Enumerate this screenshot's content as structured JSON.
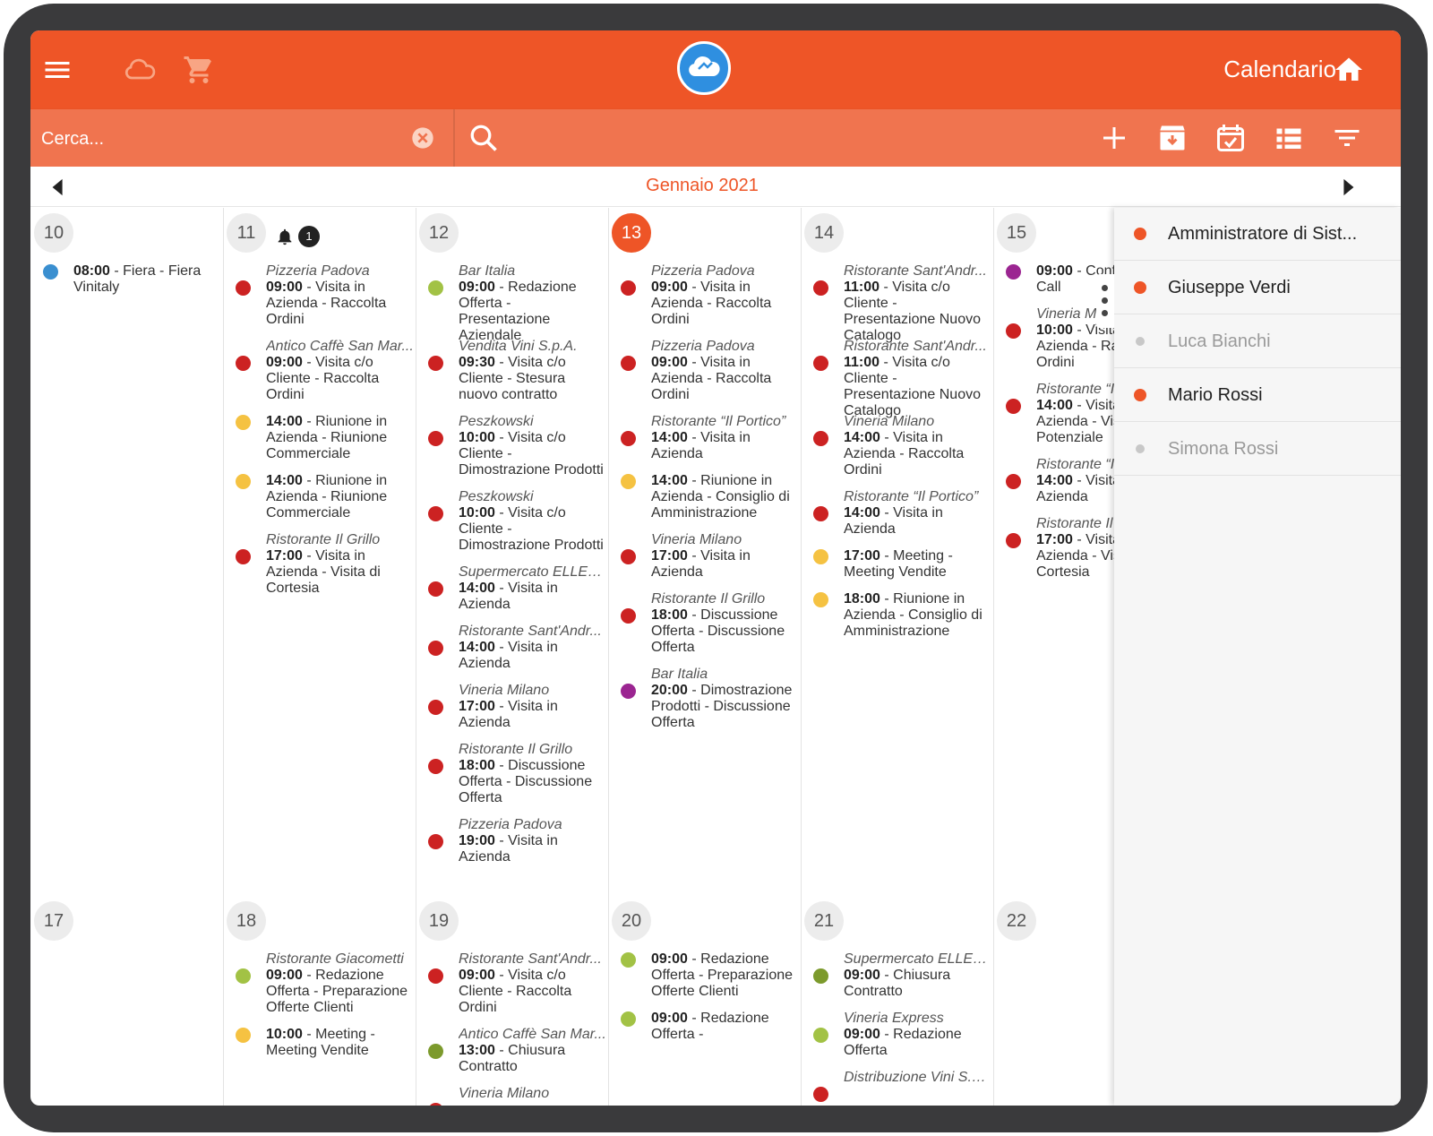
{
  "app": {
    "title": "Calendario"
  },
  "search": {
    "placeholder": "Cerca..."
  },
  "month": {
    "label": "Gennaio 2021"
  },
  "colors": {
    "accent": "#ee5527",
    "red": "#cc2222",
    "yellow": "#f5c242",
    "lightgreen": "#a2c245",
    "olive": "#7c9a2c",
    "purple": "#9b2591",
    "blue": "#3a8fd0"
  },
  "icons": [
    "menu-icon",
    "cloud-icon",
    "cart-icon",
    "home-icon",
    "close-circle-icon",
    "search-icon",
    "add-icon",
    "archive-icon",
    "calendar-check-icon",
    "list-icon",
    "filter-icon",
    "chevron-left-icon",
    "chevron-right-icon",
    "bell-icon",
    "more-vertical-icon"
  ],
  "users": [
    {
      "name": "Amministratore di Sist...",
      "active": true
    },
    {
      "name": "Giuseppe Verdi",
      "active": true
    },
    {
      "name": "Luca Bianchi",
      "active": false
    },
    {
      "name": "Mario Rossi",
      "active": true
    },
    {
      "name": "Simona Rossi",
      "active": false
    }
  ],
  "days": [
    {
      "num": "10",
      "events": [
        {
          "loc": "",
          "time": "08:00",
          "text": " - Fiera - Fiera Vinitaly",
          "color": "blue"
        }
      ]
    },
    {
      "num": "11",
      "badge": "1",
      "events": [
        {
          "loc": "Pizzeria Padova",
          "time": "09:00",
          "text": " - Visita in Azienda - Raccolta Ordini",
          "color": "red"
        },
        {
          "loc": "Antico Caffè San Mar...",
          "time": "09:00",
          "text": " - Visita c/o Cliente - Raccolta Ordini",
          "color": "red"
        },
        {
          "loc": "",
          "time": "14:00",
          "text": " - Riunione in Azienda - Riunione Commerciale",
          "color": "yellow"
        },
        {
          "loc": "",
          "time": "14:00",
          "text": " - Riunione in Azienda - Riunione Commerciale",
          "color": "yellow"
        },
        {
          "loc": "Ristorante Il Grillo",
          "time": "17:00",
          "text": " - Visita in Azienda - Visita di Cortesia",
          "color": "red"
        }
      ]
    },
    {
      "num": "12",
      "events": [
        {
          "loc": "Bar Italia",
          "time": "09:00",
          "text": " - Redazione Offerta - Presentazione Aziendale",
          "color": "lightgreen"
        },
        {
          "loc": "Vendita Vini S.p.A.",
          "time": "09:30",
          "text": " - Visita c/o Cliente - Stesura nuovo contratto",
          "color": "red"
        },
        {
          "loc": "Peszkowski",
          "time": "10:00",
          "text": " - Visita c/o Cliente - Dimostrazione Prodotti",
          "color": "red"
        },
        {
          "loc": "Peszkowski",
          "time": "10:00",
          "text": " - Visita c/o Cliente - Dimostrazione Prodotti",
          "color": "red"
        },
        {
          "loc": "Supermercato ELLES...",
          "time": "14:00",
          "text": " - Visita in Azienda",
          "color": "red"
        },
        {
          "loc": "Ristorante Sant'Andr...",
          "time": "14:00",
          "text": " - Visita in Azienda",
          "color": "red"
        },
        {
          "loc": "Vineria Milano",
          "time": "17:00",
          "text": " - Visita in Azienda",
          "color": "red"
        },
        {
          "loc": "Ristorante Il Grillo",
          "time": "18:00",
          "text": " - Discussione Offerta - Discussione Offerta",
          "color": "red"
        },
        {
          "loc": "Pizzeria Padova",
          "time": "19:00",
          "text": " - Visita in Azienda",
          "color": "red"
        }
      ]
    },
    {
      "num": "13",
      "today": true,
      "events": [
        {
          "loc": "Pizzeria Padova",
          "time": "09:00",
          "text": " - Visita in Azienda - Raccolta Ordini",
          "color": "red"
        },
        {
          "loc": "Pizzeria Padova",
          "time": "09:00",
          "text": " - Visita in Azienda - Raccolta Ordini",
          "color": "red"
        },
        {
          "loc": "Ristorante “Il Portico”",
          "time": "14:00",
          "text": " - Visita in Azienda",
          "color": "red"
        },
        {
          "loc": "",
          "time": "14:00",
          "text": " - Riunione in Azienda - Consiglio di Amministrazione",
          "color": "yellow"
        },
        {
          "loc": "Vineria Milano",
          "time": "17:00",
          "text": " - Visita in Azienda",
          "color": "red"
        },
        {
          "loc": "Ristorante Il Grillo",
          "time": "18:00",
          "text": " - Discussione Offerta - Discussione Offerta",
          "color": "red"
        },
        {
          "loc": "Bar Italia",
          "time": "20:00",
          "text": " - Dimostrazione Prodotti - Discussione Offerta",
          "color": "purple"
        }
      ]
    },
    {
      "num": "14",
      "events": [
        {
          "loc": "Ristorante Sant'Andr...",
          "time": "11:00",
          "text": " - Visita c/o Cliente - Presentazione Nuovo Catalogo",
          "color": "red"
        },
        {
          "loc": "Ristorante Sant'Andr...",
          "time": "11:00",
          "text": " - Visita c/o Cliente - Presentazione Nuovo Catalogo",
          "color": "red"
        },
        {
          "loc": "Vineria Milano",
          "time": "14:00",
          "text": " - Visita in Azienda - Raccolta Ordini",
          "color": "red"
        },
        {
          "loc": "Ristorante “Il Portico”",
          "time": "14:00",
          "text": " - Visita in Azienda",
          "color": "red"
        },
        {
          "loc": "",
          "time": "17:00",
          "text": " - Meeting - Meeting Vendite",
          "color": "yellow"
        },
        {
          "loc": "",
          "time": "18:00",
          "text": " - Riunione in Azienda - Consiglio di Amministrazione",
          "color": "yellow"
        }
      ]
    },
    {
      "num": "15",
      "events": [
        {
          "loc": "",
          "time": "09:00",
          "text": " - Conference Call",
          "color": "purple"
        },
        {
          "loc": "Vineria Milano",
          "time": "10:00",
          "text": " - Visita in Azienda - Raccolta Ordini",
          "color": "red"
        },
        {
          "loc": "Ristorante “Il Portico”",
          "time": "14:00",
          "text": " - Visita in Azienda - Visita Potenziale",
          "color": "red"
        },
        {
          "loc": "Ristorante “Il Portico”",
          "time": "14:00",
          "text": " - Visita in Azienda",
          "color": "red"
        },
        {
          "loc": "Ristorante Il Grillo",
          "time": "17:00",
          "text": " - Visita in Azienda - Visita di Cortesia",
          "color": "red"
        }
      ]
    },
    {
      "num": "17",
      "events": []
    },
    {
      "num": "18",
      "events": [
        {
          "loc": "Ristorante Giacometti",
          "time": "09:00",
          "text": " - Redazione Offerta - Preparazione Offerte Clienti",
          "color": "lightgreen"
        },
        {
          "loc": "",
          "time": "10:00",
          "text": " - Meeting - Meeting Vendite",
          "color": "yellow"
        }
      ]
    },
    {
      "num": "19",
      "events": [
        {
          "loc": "Ristorante Sant'Andr...",
          "time": "09:00",
          "text": " - Visita c/o Cliente - Raccolta Ordini",
          "color": "red"
        },
        {
          "loc": "Antico Caffè San Mar...",
          "time": "13:00",
          "text": " - Chiusura Contratto",
          "color": "olive"
        },
        {
          "loc": "Vineria Milano",
          "time": "",
          "text": "",
          "color": "red"
        }
      ]
    },
    {
      "num": "20",
      "events": [
        {
          "loc": "",
          "time": "09:00",
          "text": " - Redazione Offerta - Preparazione Offerte Clienti",
          "color": "lightgreen"
        },
        {
          "loc": "",
          "time": "09:00",
          "text": " - Redazione Offerta -",
          "color": "lightgreen"
        }
      ]
    },
    {
      "num": "21",
      "events": [
        {
          "loc": "Supermercato ELLES...",
          "time": "09:00",
          "text": " - Chiusura Contratto",
          "color": "olive"
        },
        {
          "loc": "Vineria Express",
          "time": "09:00",
          "text": " - Redazione Offerta",
          "color": "lightgreen"
        },
        {
          "loc": "Distribuzione Vini S.p...",
          "time": "",
          "text": "",
          "color": "red"
        }
      ]
    },
    {
      "num": "22",
      "events": []
    }
  ]
}
